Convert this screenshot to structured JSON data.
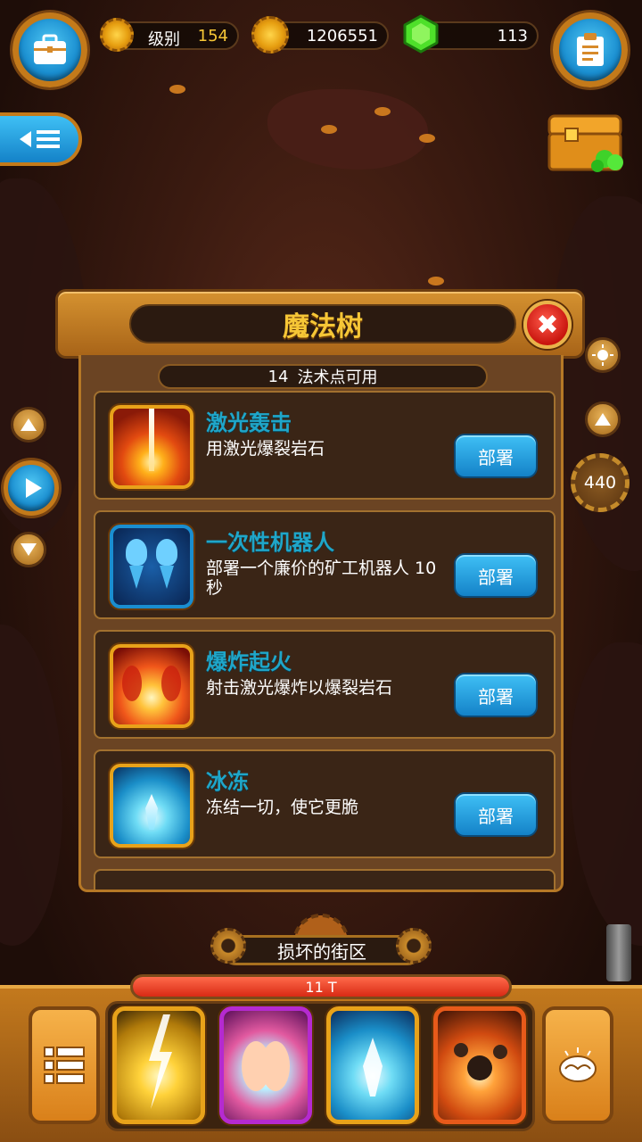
{
  "stats": {
    "level_label": "级别",
    "level_value": "154",
    "coins_value": "1206551",
    "gems_value": "113"
  },
  "right_counter": "440",
  "dialog": {
    "title": "魔法树",
    "points_count": "14",
    "points_label": "法术点可用",
    "deploy_label": "部署"
  },
  "spells": [
    {
      "name": "激光轰击",
      "desc": "用激光爆裂岩石",
      "icon": "laser-beam-icon"
    },
    {
      "name": "一次性机器人",
      "desc": "部署一个廉价的矿工机器人 10秒",
      "icon": "robot-miner-icon"
    },
    {
      "name": "爆炸起火",
      "desc": "射击激光爆炸以爆裂岩石",
      "icon": "explosion-fire-icon"
    },
    {
      "name": "冰冻",
      "desc": "冻结一切，使它更脆",
      "icon": "ice-freeze-icon"
    }
  ],
  "bottom": {
    "zone_name": "损坏的街区",
    "progress_label": "11 T",
    "progress_fraction": 1.0
  },
  "colors": {
    "accent_blue": "#1a8ed0",
    "frame_gold": "#e8a21a",
    "title_yellow": "#f6c636",
    "spell_title_cyan": "#1fa6c9",
    "progress_red": "#d82a14"
  }
}
